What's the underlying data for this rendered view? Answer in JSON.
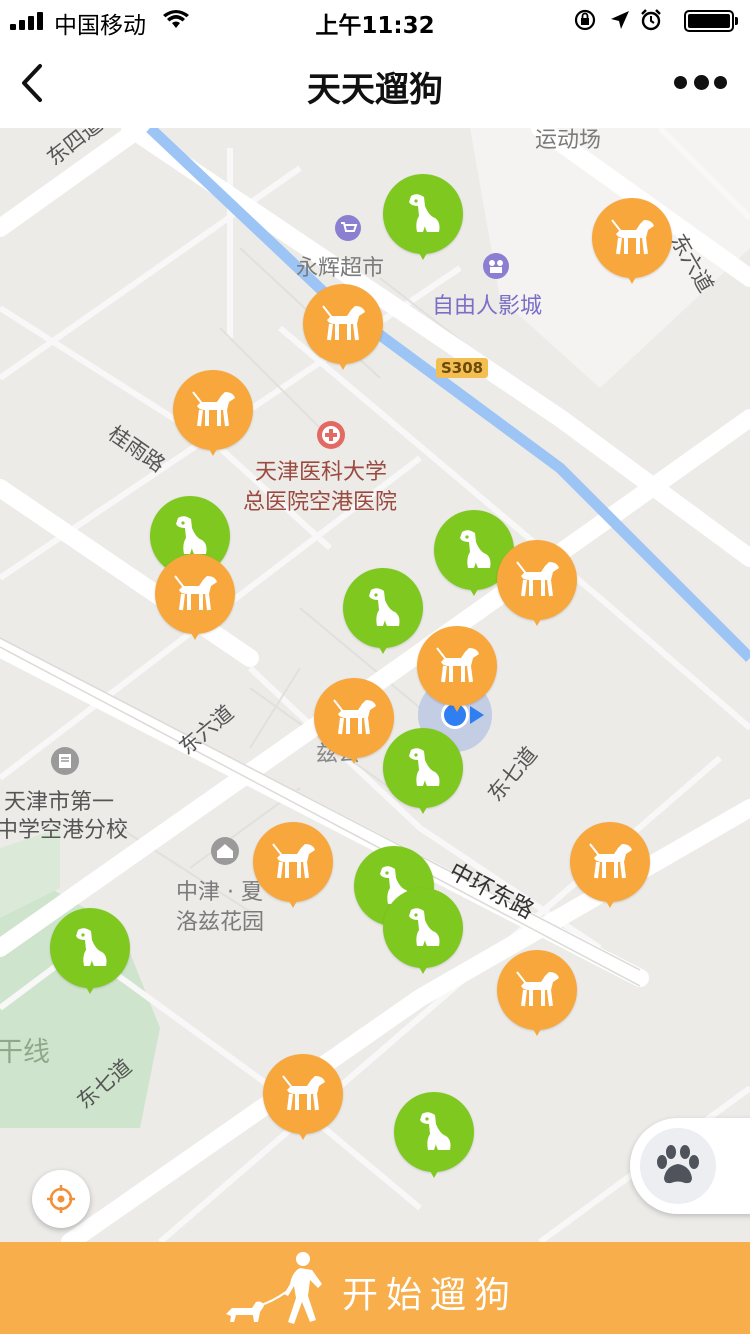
{
  "status_bar": {
    "carrier": "中国移动",
    "time": "上午11:32",
    "icons": [
      "signal-icon",
      "wifi-icon",
      "orientation-lock-icon",
      "location-arrow-icon",
      "alarm-icon",
      "battery-icon"
    ]
  },
  "nav": {
    "title": "天天遛狗",
    "back_icon": "chevron-left-icon",
    "more_icon": "more-dots-icon"
  },
  "map": {
    "labels": {
      "road_dongsidao": "东四道",
      "yunyunchang": "运动场",
      "yonghui": "永辉超市",
      "cinema": "自由人影城",
      "road_dongliudao_top": "东六道",
      "highway": "S308",
      "guiyulu": "桂雨路",
      "hospital_line1": "天津医科大学",
      "hospital_line2": "总医院空港医院",
      "road_dongliudao": "东六道",
      "road_dongqidao": "东七道",
      "school_line1": "天津市第一",
      "school_line2": "中学空港分校",
      "zhongjin_line1": "中津 · 夏",
      "zhongjin_line2": "洛兹花园",
      "zhonghuandonglu": "中环东路",
      "ganxian": "干线",
      "road_dongqidao_bottom": "东七道",
      "partial_poi": "兹公"
    },
    "colors": {
      "map_bg": "#ecebe8",
      "road": "#ffffff",
      "river": "#9cc4f5",
      "park": "#cfe4cc",
      "marker_orange": "#f7a73c",
      "marker_green": "#7ec81f",
      "accent_bar": "#f7ae4b"
    },
    "markers": [
      {
        "type": "green",
        "kind": "sitting-dog"
      },
      {
        "type": "orange",
        "kind": "walking-dog"
      },
      {
        "type": "orange",
        "kind": "walking-dog"
      },
      {
        "type": "orange",
        "kind": "walking-dog"
      },
      {
        "type": "green",
        "kind": "sitting-dog"
      },
      {
        "type": "orange",
        "kind": "walking-dog"
      },
      {
        "type": "green",
        "kind": "sitting-dog"
      },
      {
        "type": "orange",
        "kind": "walking-dog"
      },
      {
        "type": "green",
        "kind": "sitting-dog"
      },
      {
        "type": "orange",
        "kind": "walking-dog"
      },
      {
        "type": "orange",
        "kind": "walking-dog"
      },
      {
        "type": "green",
        "kind": "sitting-dog"
      },
      {
        "type": "orange",
        "kind": "walking-dog"
      },
      {
        "type": "green",
        "kind": "sitting-dog"
      },
      {
        "type": "green",
        "kind": "sitting-dog"
      },
      {
        "type": "orange",
        "kind": "walking-dog"
      },
      {
        "type": "green",
        "kind": "sitting-dog"
      },
      {
        "type": "orange",
        "kind": "walking-dog"
      },
      {
        "type": "orange",
        "kind": "walking-dog"
      },
      {
        "type": "orange",
        "kind": "walking-dog"
      },
      {
        "type": "green",
        "kind": "sitting-dog"
      }
    ],
    "locate_icon": "locate-target-icon",
    "paw_icon": "paw-icon"
  },
  "start": {
    "label": "开始遛狗",
    "icon": "person-walking-dog-icon"
  }
}
